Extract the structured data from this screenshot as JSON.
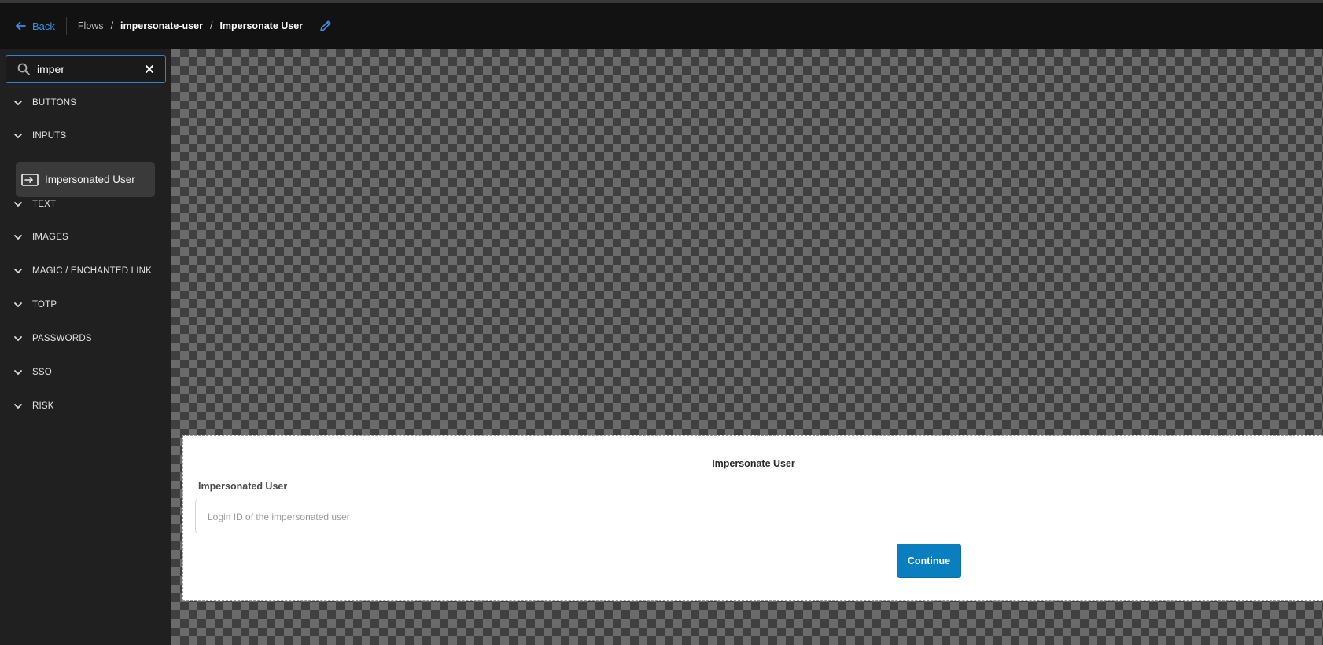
{
  "header": {
    "back_label": "Back",
    "breadcrumb": {
      "root": "Flows",
      "flow": "impersonate-user",
      "screen": "Impersonate User"
    }
  },
  "sidebar": {
    "search": {
      "value": "imper",
      "placeholder": ""
    },
    "categories": [
      "BUTTONS",
      "INPUTS",
      "TEXT",
      "IMAGES",
      "MAGIC / ENCHANTED LINK",
      "TOTP",
      "PASSWORDS",
      "SSO",
      "RISK"
    ],
    "inputs_items": [
      "Impersonated User"
    ]
  },
  "screen": {
    "title": "Impersonate User",
    "field_label": "Impersonated User",
    "field_placeholder": "Login ID of the impersonated user",
    "button_label": "Continue"
  },
  "colors": {
    "accent": "#2f84d6",
    "button": "#0a7fbf"
  }
}
